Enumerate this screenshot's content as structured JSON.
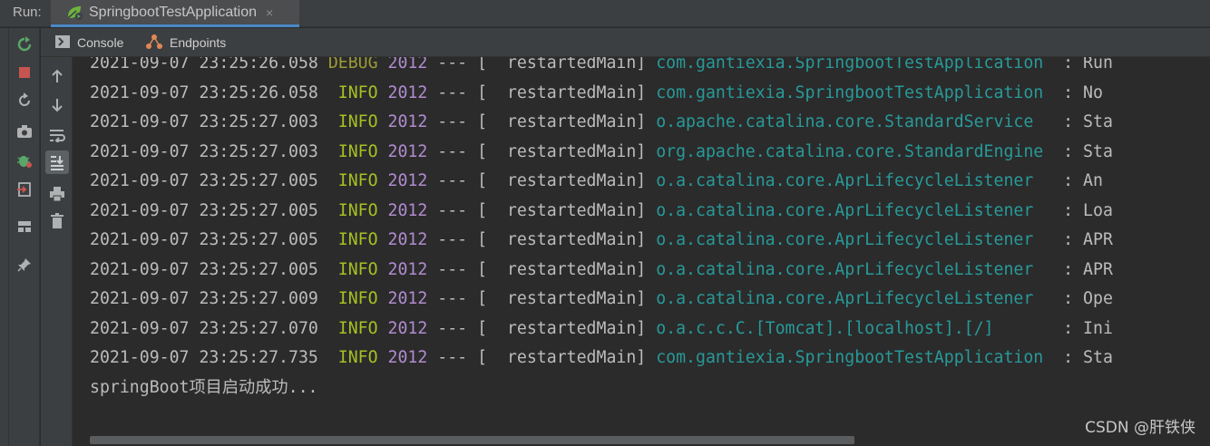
{
  "runbar": {
    "label": "Run:",
    "tab_title": "SpringbootTestApplication",
    "close_glyph": "×"
  },
  "tabs": [
    {
      "label": "Console",
      "icon": "console-icon"
    },
    {
      "label": "Endpoints",
      "icon": "endpoints-icon"
    }
  ],
  "left_actions": [
    "rerun-icon",
    "stop-icon",
    "restore-icon",
    "screenshot-icon",
    "debug-icon",
    "exit-icon",
    "layout-icon",
    "pin-icon"
  ],
  "inner_actions": [
    "up-arrow-icon",
    "down-arrow-icon",
    "soft-wrap-icon",
    "scroll-to-end-icon",
    "print-icon",
    "trash-icon"
  ],
  "log_lines": [
    {
      "ts": "2021-09-07 23:25:26.058",
      "level": "DEBUG",
      "pid": "2012",
      "sep": "---",
      "thread": "[  restartedMain]",
      "logger": "com.gantiexia.SpringbootTestApplication",
      "msg": "  : Run"
    },
    {
      "ts": "2021-09-07 23:25:26.058",
      "level": " INFO",
      "pid": "2012",
      "sep": "---",
      "thread": "[  restartedMain]",
      "logger": "com.gantiexia.SpringbootTestApplication",
      "msg": "  : No "
    },
    {
      "ts": "2021-09-07 23:25:27.003",
      "level": " INFO",
      "pid": "2012",
      "sep": "---",
      "thread": "[  restartedMain]",
      "logger": "o.apache.catalina.core.StandardService ",
      "msg": "  : Sta"
    },
    {
      "ts": "2021-09-07 23:25:27.003",
      "level": " INFO",
      "pid": "2012",
      "sep": "---",
      "thread": "[  restartedMain]",
      "logger": "org.apache.catalina.core.StandardEngine",
      "msg": "  : Sta"
    },
    {
      "ts": "2021-09-07 23:25:27.005",
      "level": " INFO",
      "pid": "2012",
      "sep": "---",
      "thread": "[  restartedMain]",
      "logger": "o.a.catalina.core.AprLifecycleListener ",
      "msg": "  : An "
    },
    {
      "ts": "2021-09-07 23:25:27.005",
      "level": " INFO",
      "pid": "2012",
      "sep": "---",
      "thread": "[  restartedMain]",
      "logger": "o.a.catalina.core.AprLifecycleListener ",
      "msg": "  : Loa"
    },
    {
      "ts": "2021-09-07 23:25:27.005",
      "level": " INFO",
      "pid": "2012",
      "sep": "---",
      "thread": "[  restartedMain]",
      "logger": "o.a.catalina.core.AprLifecycleListener ",
      "msg": "  : APR"
    },
    {
      "ts": "2021-09-07 23:25:27.005",
      "level": " INFO",
      "pid": "2012",
      "sep": "---",
      "thread": "[  restartedMain]",
      "logger": "o.a.catalina.core.AprLifecycleListener ",
      "msg": "  : APR"
    },
    {
      "ts": "2021-09-07 23:25:27.009",
      "level": " INFO",
      "pid": "2012",
      "sep": "---",
      "thread": "[  restartedMain]",
      "logger": "o.a.catalina.core.AprLifecycleListener ",
      "msg": "  : Ope"
    },
    {
      "ts": "2021-09-07 23:25:27.070",
      "level": " INFO",
      "pid": "2012",
      "sep": "---",
      "thread": "[  restartedMain]",
      "logger": "o.a.c.c.C.[Tomcat].[localhost].[/]     ",
      "msg": "  : Ini"
    },
    {
      "ts": "2021-09-07 23:25:27.735",
      "level": " INFO",
      "pid": "2012",
      "sep": "---",
      "thread": "[  restartedMain]",
      "logger": "com.gantiexia.SpringbootTestApplication",
      "msg": "  : Sta"
    }
  ],
  "final_line": "springBoot项目启动成功...",
  "watermark": "CSDN @肝铁侠",
  "colors": {
    "info": "#a8c023",
    "debug": "#9c9a37",
    "pid": "#b08bcf",
    "logger": "#299999",
    "text": "#bbbbbb",
    "background": "#2b2b2b"
  }
}
